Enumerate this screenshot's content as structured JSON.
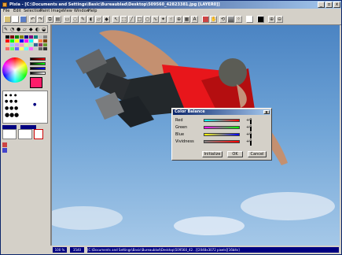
{
  "window": {
    "title": "PIxia - [C:\\Documents and Settings\\Basic\\Bureaublad\\Desktop\\509560_42823381.jpg [LAYER0]]",
    "min_label": "_",
    "max_label": "▫",
    "close_label": "x"
  },
  "menu": [
    "File",
    "Edit",
    "Selection",
    "Paint",
    "Image",
    "View",
    "Window",
    "Help"
  ],
  "toolbar_icons": [
    "folder-open-icon",
    "new-icon",
    "save-icon",
    "undo-icon",
    "redo-icon",
    "copy-icon",
    "paste-icon",
    "select-rect-icon",
    "select-lasso-icon",
    "pen-icon",
    "brush-icon",
    "eraser-icon",
    "fill-icon",
    "zoom-in-icon",
    "zoom-out-icon"
  ],
  "sidebar": {
    "palette_colors": [
      "#000000",
      "#800000",
      "#008000",
      "#808000",
      "#000080",
      "#800080",
      "#008080",
      "#c0c0c0",
      "#808080",
      "#ff0000",
      "#00ff00",
      "#ffff00",
      "#0000ff",
      "#ff00ff",
      "#00ffff",
      "#ffffff",
      "#ff8040",
      "#804000",
      "#ffcc99",
      "#99ccff",
      "#cc99ff",
      "#ff99cc",
      "#ccff99",
      "#99ffcc",
      "#336699",
      "#993366",
      "#669933",
      "#ff6666",
      "#66ff66",
      "#6666ff",
      "#ffff66",
      "#66ffff",
      "#ff66ff",
      "#cccccc",
      "#666666",
      "#333333"
    ],
    "current_color": "#ff1c6a",
    "zoom_label": "100 %"
  },
  "status": {
    "left": "100 %",
    "middle": "3540",
    "path": "[C:\\Documents and Settings\\Basic\\Bureaublad\\Desktop\\509560_42...][2048x3072 pixels][16bits]"
  },
  "dialog": {
    "title": "Color Balance",
    "close_label": "x",
    "rows": [
      {
        "label": "Red",
        "value": "+0",
        "gradient": "linear-gradient(to right,#00ffff,#ff0000)"
      },
      {
        "label": "Green",
        "value": "+0",
        "gradient": "linear-gradient(to right,#ff00ff,#00ff00)"
      },
      {
        "label": "Blue",
        "value": "+0",
        "gradient": "linear-gradient(to right,#ffff00,#0000ff)"
      },
      {
        "label": "Vividness",
        "value": "+0",
        "gradient": "linear-gradient(to right,#808080,#ff0000)"
      }
    ],
    "buttons": {
      "initialize": "Initialize",
      "ok": "OK",
      "cancel": "Cancel"
    }
  }
}
